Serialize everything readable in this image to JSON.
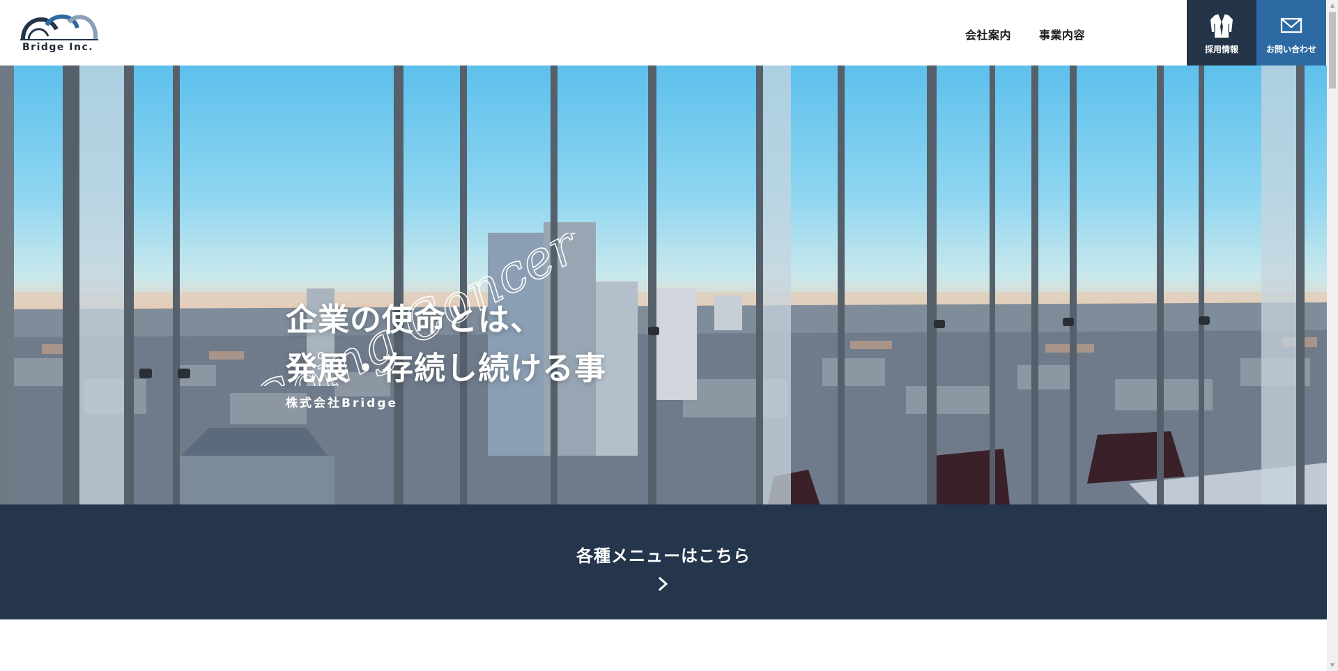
{
  "header": {
    "logo": {
      "text": "Bridge Inc.",
      "icon": "bridge-arches-logo"
    },
    "nav": [
      {
        "label": "会社案内"
      },
      {
        "label": "事業内容"
      }
    ],
    "recruit": {
      "label": "採用情報",
      "icon": "suit-icon",
      "color": "#243448"
    },
    "contact": {
      "label": "お問い合わせ",
      "icon": "mail-icon",
      "color": "#2d6aa3"
    }
  },
  "hero": {
    "script_text": "Going Concern",
    "headline": [
      "企業の使命とは、",
      "発展・存続し続ける事"
    ],
    "company": "株式会社Bridge"
  },
  "menu_band": {
    "label": "各種メニューはこちら",
    "icon": "chevron-right-icon",
    "color": "#25354b"
  },
  "scrollbar": {
    "up_icon": "▲",
    "down_icon": "▼"
  }
}
